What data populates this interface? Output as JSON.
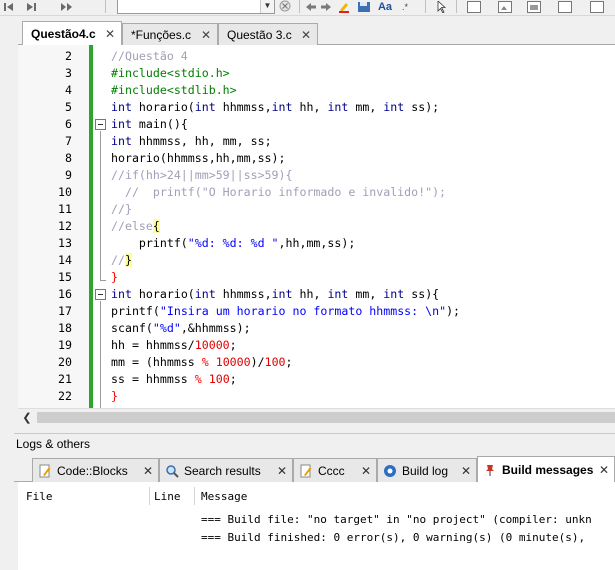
{
  "toolbar": {
    "buttons": [
      "back-arrow-icon",
      "forward-arrow-icon",
      "jump-icon",
      "combo",
      "dropdown-icon",
      "clear-icon",
      "nav-back-icon",
      "nav-forward-icon",
      "highlight-icon",
      "save-icon",
      "find-icon",
      "abbr-icon",
      "pointer-icon"
    ],
    "combo_value": ""
  },
  "editor_tabs": [
    {
      "label": "Questão4.c",
      "active": true
    },
    {
      "label": "*Funções.c",
      "active": false
    },
    {
      "label": "Questão 3.c",
      "active": false
    }
  ],
  "editor": {
    "line_numbers": [
      "2",
      "3",
      "4",
      "5",
      "6",
      "7",
      "8",
      "9",
      "10",
      "11",
      "12",
      "13",
      "14",
      "15",
      "16",
      "17",
      "18",
      "19",
      "20",
      "21",
      "22"
    ]
  },
  "code": {
    "l2": "//Questão 4",
    "l3": "#include<stdio.h>",
    "l4": "#include<stdlib.h>",
    "l5a": "int",
    "l5b": " horario(",
    "l5c": "int",
    "l5d": " hhmmss,",
    "l5e": "int",
    "l5f": " hh, ",
    "l5g": "int",
    "l5h": " mm, ",
    "l5i": "int",
    "l5j": " ss);",
    "l6a": "int",
    "l6b": " main(){",
    "l7a": "int",
    "l7b": " hhmmss, hh, mm, ss;",
    "l8": "horario(hhmmss,hh,mm,ss);",
    "l9": "//if(hh>24||mm>59||ss>59){",
    "l10": "  //  printf(\"O Horario informado e invalido!\");",
    "l11": "//}",
    "l12a": "//else",
    "l12b": "{",
    "l13a": "    printf(",
    "l13b": "\"%d: %d: %d \"",
    "l13c": ",hh,mm,ss);",
    "l14a": "//",
    "l14b": "}",
    "l15": "}",
    "l16a": "int",
    "l16b": " horario(",
    "l16c": "int",
    "l16d": " hhmmss,",
    "l16e": "int",
    "l16f": " hh, ",
    "l16g": "int",
    "l16h": " mm, ",
    "l16i": "int",
    "l16j": " ss){",
    "l17a": "printf(",
    "l17b": "\"Insira um horario no formato hhmmss: \\n\"",
    "l17c": ");",
    "l18a": "scanf(",
    "l18b": "\"%d\"",
    "l18c": ",&hhmmss);",
    "l19a": "hh = hhmmss/",
    "l19b": "10000",
    "l19c": ";",
    "l20a": "mm = (hhmmss ",
    "l20b": "%",
    "l20c": " ",
    "l20d": "10000",
    "l20e": ")/",
    "l20f": "100",
    "l20g": ";",
    "l21a": "ss = hhmmss ",
    "l21b": "%",
    "l21c": " ",
    "l21d": "100",
    "l21e": ";",
    "l22": "}"
  },
  "logs": {
    "title": "Logs & others",
    "tabs": [
      {
        "label": "Code::Blocks",
        "icon": "pencil-doc-icon",
        "active": false
      },
      {
        "label": "Search results",
        "icon": "magnifier-icon",
        "active": false
      },
      {
        "label": "Cccc",
        "icon": "pencil-doc-icon",
        "active": false
      },
      {
        "label": "Build log",
        "icon": "gear-icon",
        "active": false
      },
      {
        "label": "Build messages",
        "icon": "pin-icon",
        "active": true
      }
    ],
    "columns": {
      "file": "File",
      "line": "Line",
      "message": "Message"
    },
    "messages": [
      "=== Build file: \"no target\" in \"no project\" (compiler: unkn",
      "=== Build finished: 0 error(s), 0 warning(s) (0 minute(s),"
    ]
  },
  "colors": {
    "change_bar": "#2ea42e",
    "keyword": "#00008b",
    "preprocessor": "#008000",
    "comment": "#a0a0b8",
    "string": "#0000ff",
    "number": "#e00000",
    "brace_highlight": "#ffff99"
  }
}
